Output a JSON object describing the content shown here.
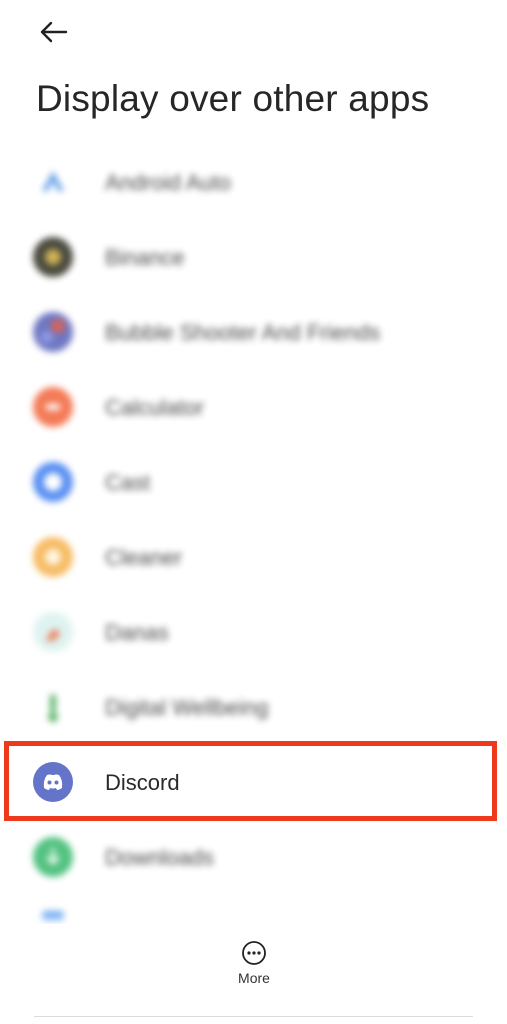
{
  "header": {
    "back_icon": "arrow-left-icon",
    "title": "Display over other apps"
  },
  "apps": [
    {
      "id": "android-auto",
      "label": "Android Auto",
      "icon": "android-auto-icon",
      "color": "#4a90e2",
      "blurred": true
    },
    {
      "id": "binance",
      "label": "Binance",
      "icon": "binance-icon",
      "color": "#2b2b1e",
      "blurred": true
    },
    {
      "id": "bubble-shooter",
      "label": "Bubble Shooter And Friends",
      "icon": "bubble-shooter-icon",
      "color": "#5560b8",
      "blurred": true
    },
    {
      "id": "calculator",
      "label": "Calculator",
      "icon": "calculator-icon",
      "color": "#f2643a",
      "blurred": true
    },
    {
      "id": "cast",
      "label": "Cast",
      "icon": "cast-icon",
      "color": "#3d7cf0",
      "blurred": true
    },
    {
      "id": "cleaner",
      "label": "Cleaner",
      "icon": "cleaner-icon",
      "color": "#f5b04a",
      "blurred": true
    },
    {
      "id": "danas",
      "label": "Danas",
      "icon": "danas-icon",
      "color": "#e9704a",
      "blurred": true
    },
    {
      "id": "digital-wellbeing",
      "label": "Digital Wellbeing",
      "icon": "digital-wellbeing-icon",
      "color": "#3fa84f",
      "blurred": true
    },
    {
      "id": "discord",
      "label": "Discord",
      "icon": "discord-icon",
      "color": "#6474c9",
      "blurred": false,
      "highlighted": true
    },
    {
      "id": "downloads",
      "label": "Downloads",
      "icon": "downloads-icon",
      "color": "#35b86a",
      "blurred": true
    }
  ],
  "highlight_color": "#ee3a1c",
  "footer": {
    "more_icon": "more-dots-icon",
    "more_label": "More"
  }
}
